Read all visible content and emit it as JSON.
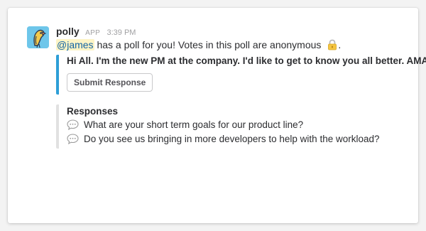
{
  "message": {
    "sender": "polly",
    "badge": "APP",
    "time": "3:39 PM",
    "mention": "@james",
    "text": "has a poll for you! Votes in this poll are anonymous",
    "trailing": ".",
    "icons": {
      "avatar": "parrot-icon",
      "lock": "lock-icon"
    }
  },
  "poll": {
    "question": "Hi All. I'm the new PM at the company. I'd like to get to know you all better. AMA",
    "submit_label": "Submit Response",
    "accent_color": "#2e9fd7"
  },
  "responses": {
    "title": "Responses",
    "items": [
      "What are your short term goals for our product line?",
      "Do you see us bringing in more developers to help with the workload?"
    ],
    "icon": "speech-bubble-icon"
  }
}
